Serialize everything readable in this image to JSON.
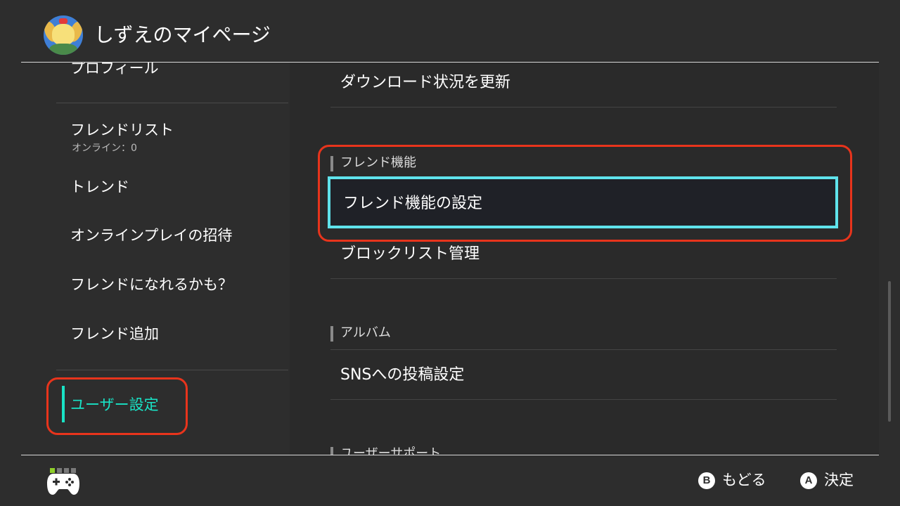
{
  "header": {
    "title": "しずえのマイページ",
    "avatar_icon": "avatar-icon"
  },
  "sidebar": {
    "items": [
      {
        "label": "プロフィール"
      },
      {
        "label": "フレンドリスト",
        "sublabel": "オンライン：0"
      },
      {
        "label": "トレンド"
      },
      {
        "label": "オンラインプレイの招待"
      },
      {
        "label": "フレンドになれるかも？"
      },
      {
        "label": "フレンド追加"
      },
      {
        "label": "ユーザー設定",
        "active": true
      }
    ]
  },
  "content": {
    "top_item": "ダウンロード状況を更新",
    "sections": [
      {
        "title": "フレンド機能",
        "items": [
          "フレンド機能の設定",
          "ブロックリスト管理"
        ],
        "selected": "フレンド機能の設定"
      },
      {
        "title": "アルバム",
        "items": [
          "SNSへの投稿設定"
        ]
      },
      {
        "title": "ユーザーサポート",
        "items": []
      }
    ]
  },
  "footer": {
    "back": {
      "button": "B",
      "label": "もどる"
    },
    "confirm": {
      "button": "A",
      "label": "決定"
    },
    "controller_icon": "gamepad-icon"
  },
  "colors": {
    "accent": "#19e3c6",
    "selection_border": "#5fe3ec",
    "annotation": "#e8341c"
  }
}
